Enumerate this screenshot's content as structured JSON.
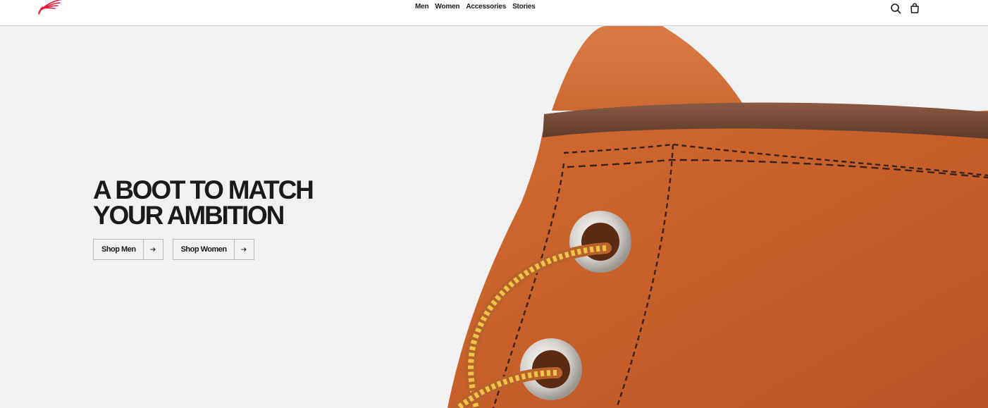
{
  "header": {
    "logo_icon": "red-wing-logo-icon",
    "nav": [
      "Men",
      "Women",
      "Accessories",
      "Stories"
    ],
    "search_icon": "search-icon",
    "cart_icon": "shopping-bag-icon"
  },
  "hero": {
    "headline_line1": "A BOOT TO MATCH",
    "headline_line2": "YOUR AMBITION",
    "cta_men": "Shop Men",
    "cta_women": "Shop Women",
    "arrow_icon": "arrow-right-icon",
    "image": "boot-closeup-image"
  },
  "colors": {
    "brand_red": "#e31837",
    "hero_bg": "#f1f1f1",
    "leather": "#c9622d"
  }
}
